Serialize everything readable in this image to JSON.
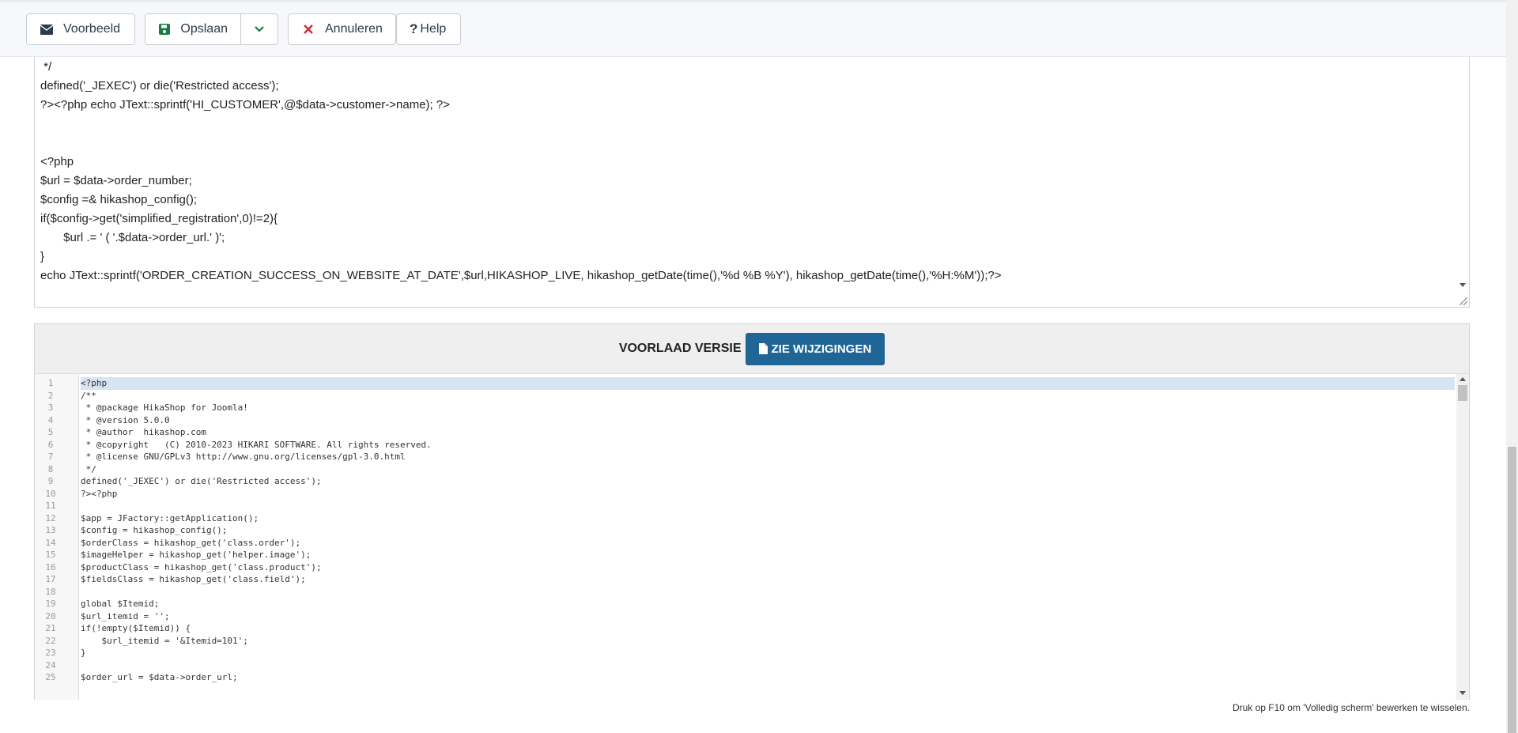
{
  "toolbar": {
    "preview_label": "Voorbeeld",
    "save_label": "Opslaan",
    "cancel_label": "Annuleren",
    "help_label": "Help"
  },
  "editor_top": {
    "lines": [
      " */",
      "defined('_JEXEC') or die('Restricted access');",
      "?><?php echo JText::sprintf('HI_CUSTOMER',@$data->customer->name); ?>",
      "",
      "",
      "<?php",
      "$url = $data->order_number;",
      "$config =& hikashop_config();",
      "if($config->get('simplified_registration',0)!=2){",
      "       $url .= ' ( '.$data->order_url.' )';",
      "}",
      "echo JText::sprintf('ORDER_CREATION_SUCCESS_ON_WEBSITE_AT_DATE',$url,HIKASHOP_LIVE, hikashop_getDate(time(),'%d %B %Y'), hikashop_getDate(time(),'%H:%M'));?>"
    ]
  },
  "preview": {
    "title": "VOORLAAD VERSIE",
    "diff_button": "ZIE WIJZIGINGEN"
  },
  "code": {
    "lines": [
      {
        "n": "1",
        "t": "<?php"
      },
      {
        "n": "2",
        "t": "/**"
      },
      {
        "n": "3",
        "t": " * @package HikaShop for Joomla!"
      },
      {
        "n": "4",
        "t": " * @version 5.0.0"
      },
      {
        "n": "5",
        "t": " * @author  hikashop.com"
      },
      {
        "n": "6",
        "t": " * @copyright   (C) 2010-2023 HIKARI SOFTWARE. All rights reserved."
      },
      {
        "n": "7",
        "t": " * @license GNU/GPLv3 http://www.gnu.org/licenses/gpl-3.0.html"
      },
      {
        "n": "8",
        "t": " */"
      },
      {
        "n": "9",
        "t": "defined('_JEXEC') or die('Restricted access');"
      },
      {
        "n": "10",
        "t": "?><?php"
      },
      {
        "n": "11",
        "t": ""
      },
      {
        "n": "12",
        "t": "$app = JFactory::getApplication();"
      },
      {
        "n": "13",
        "t": "$config = hikashop_config();"
      },
      {
        "n": "14",
        "t": "$orderClass = hikashop_get('class.order');"
      },
      {
        "n": "15",
        "t": "$imageHelper = hikashop_get('helper.image');"
      },
      {
        "n": "16",
        "t": "$productClass = hikashop_get('class.product');"
      },
      {
        "n": "17",
        "t": "$fieldsClass = hikashop_get('class.field');"
      },
      {
        "n": "18",
        "t": ""
      },
      {
        "n": "19",
        "t": "global $Itemid;"
      },
      {
        "n": "20",
        "t": "$url_itemid = '';"
      },
      {
        "n": "21",
        "t": "if(!empty($Itemid)) {"
      },
      {
        "n": "22",
        "t": "    $url_itemid = '&Itemid=101';"
      },
      {
        "n": "23",
        "t": "}"
      },
      {
        "n": "24",
        "t": ""
      },
      {
        "n": "25",
        "t": "$order_url = $data->order_url;"
      }
    ]
  },
  "footer": {
    "note": "Druk op F10 om 'Volledig scherm' bewerken te wisselen."
  },
  "colors": {
    "accent": "#1f6596",
    "save_icon": "#1e7a45",
    "cancel_icon": "#c9302c",
    "active_line": "#d7e4f2"
  },
  "icons": {
    "preview": "envelope-icon",
    "save": "floppy-icon",
    "dropdown": "chevron-down-icon",
    "cancel": "close-icon",
    "help": "question-icon",
    "diff": "file-icon"
  }
}
